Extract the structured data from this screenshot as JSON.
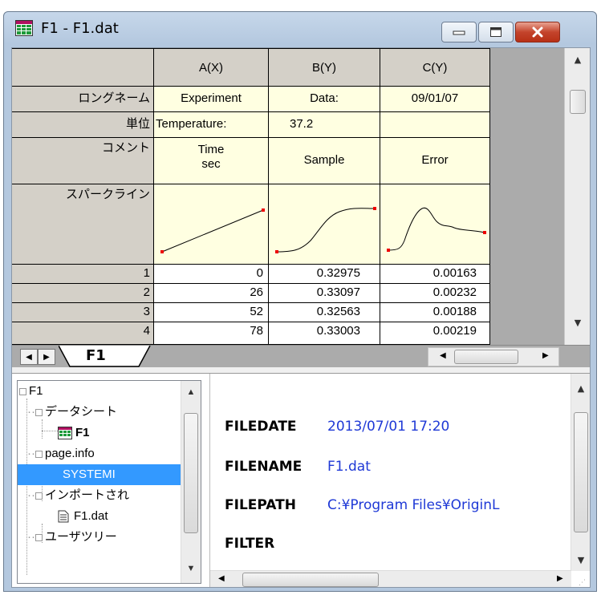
{
  "window": {
    "title": "F1 - F1.dat"
  },
  "columns": [
    {
      "name": "A(X)"
    },
    {
      "name": "B(Y)"
    },
    {
      "name": "C(Y)"
    }
  ],
  "row_labels": {
    "long_name": "ロングネーム",
    "units": "単位",
    "comments": "コメント",
    "sparklines": "スパークライン"
  },
  "long_names": [
    "Experiment",
    "Data:",
    "09/01/07"
  ],
  "units": [
    "Temperature:",
    "37.2",
    ""
  ],
  "comments": [
    [
      "Time",
      "sec"
    ],
    [
      "Sample",
      ""
    ],
    [
      "Error",
      ""
    ]
  ],
  "rows": [
    {
      "index": "1",
      "a": "0",
      "b": "0.32975",
      "c": "0.00163"
    },
    {
      "index": "2",
      "a": "26",
      "b": "0.33097",
      "c": "0.00232"
    },
    {
      "index": "3",
      "a": "52",
      "b": "0.32563",
      "c": "0.00188"
    },
    {
      "index": "4",
      "a": "78",
      "b": "0.33003",
      "c": "0.00219"
    }
  ],
  "sheet_tab": "F1",
  "tree": {
    "root": "F1",
    "datasheet": "データシート",
    "datasheet_child": "F1",
    "page_info": "page.info",
    "system_info": "SYSTEMI",
    "import": "インポートされ",
    "import_child": "F1.dat",
    "user_tree": "ユーザツリー"
  },
  "info": [
    {
      "key": "FILEDATE",
      "value": "2013/07/01 17:20"
    },
    {
      "key": "FILENAME",
      "value": "F1.dat"
    },
    {
      "key": "FILEPATH",
      "value": "C:¥Program Files¥OriginL"
    },
    {
      "key": "FILTER",
      "value": ""
    }
  ],
  "colors": {
    "header_bg": "#d4d0c8",
    "label_bg": "#ffffe1",
    "selection": "#3399ff",
    "info_value": "#1f39d6"
  }
}
